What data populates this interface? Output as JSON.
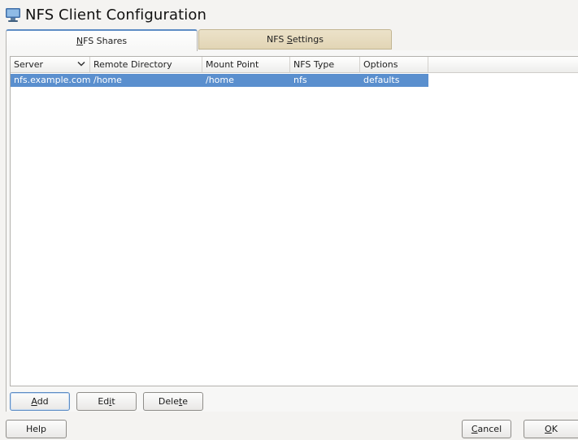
{
  "window": {
    "title": "NFS Client Configuration",
    "icon": "monitor-icon"
  },
  "tabs": [
    {
      "pre": "",
      "key": "N",
      "post": "FS Shares",
      "active": true
    },
    {
      "pre": "NFS ",
      "key": "S",
      "post": "ettings",
      "active": false
    }
  ],
  "table": {
    "columns": [
      "Server",
      "Remote Directory",
      "Mount Point",
      "NFS Type",
      "Options"
    ],
    "sort_icon": "chevron-down-icon",
    "rows": [
      {
        "server": "nfs.example.com",
        "remote_directory": "/home",
        "mount_point": "/home",
        "nfs_type": "nfs",
        "options": "defaults",
        "selected": true
      }
    ]
  },
  "actions": {
    "add": {
      "pre": "",
      "key": "A",
      "post": "dd"
    },
    "edit": {
      "pre": "Ed",
      "key": "i",
      "post": "t"
    },
    "delete": {
      "pre": "Dele",
      "key": "t",
      "post": "e"
    }
  },
  "footer": {
    "help": "Help",
    "cancel": {
      "pre": "",
      "key": "C",
      "post": "ancel"
    },
    "ok": {
      "pre": "",
      "key": "O",
      "post": "K"
    }
  },
  "colors": {
    "selection": "#5a8fce",
    "active_tab_accent": "#5d8cc4",
    "inactive_tab": "#e5d9bb"
  }
}
